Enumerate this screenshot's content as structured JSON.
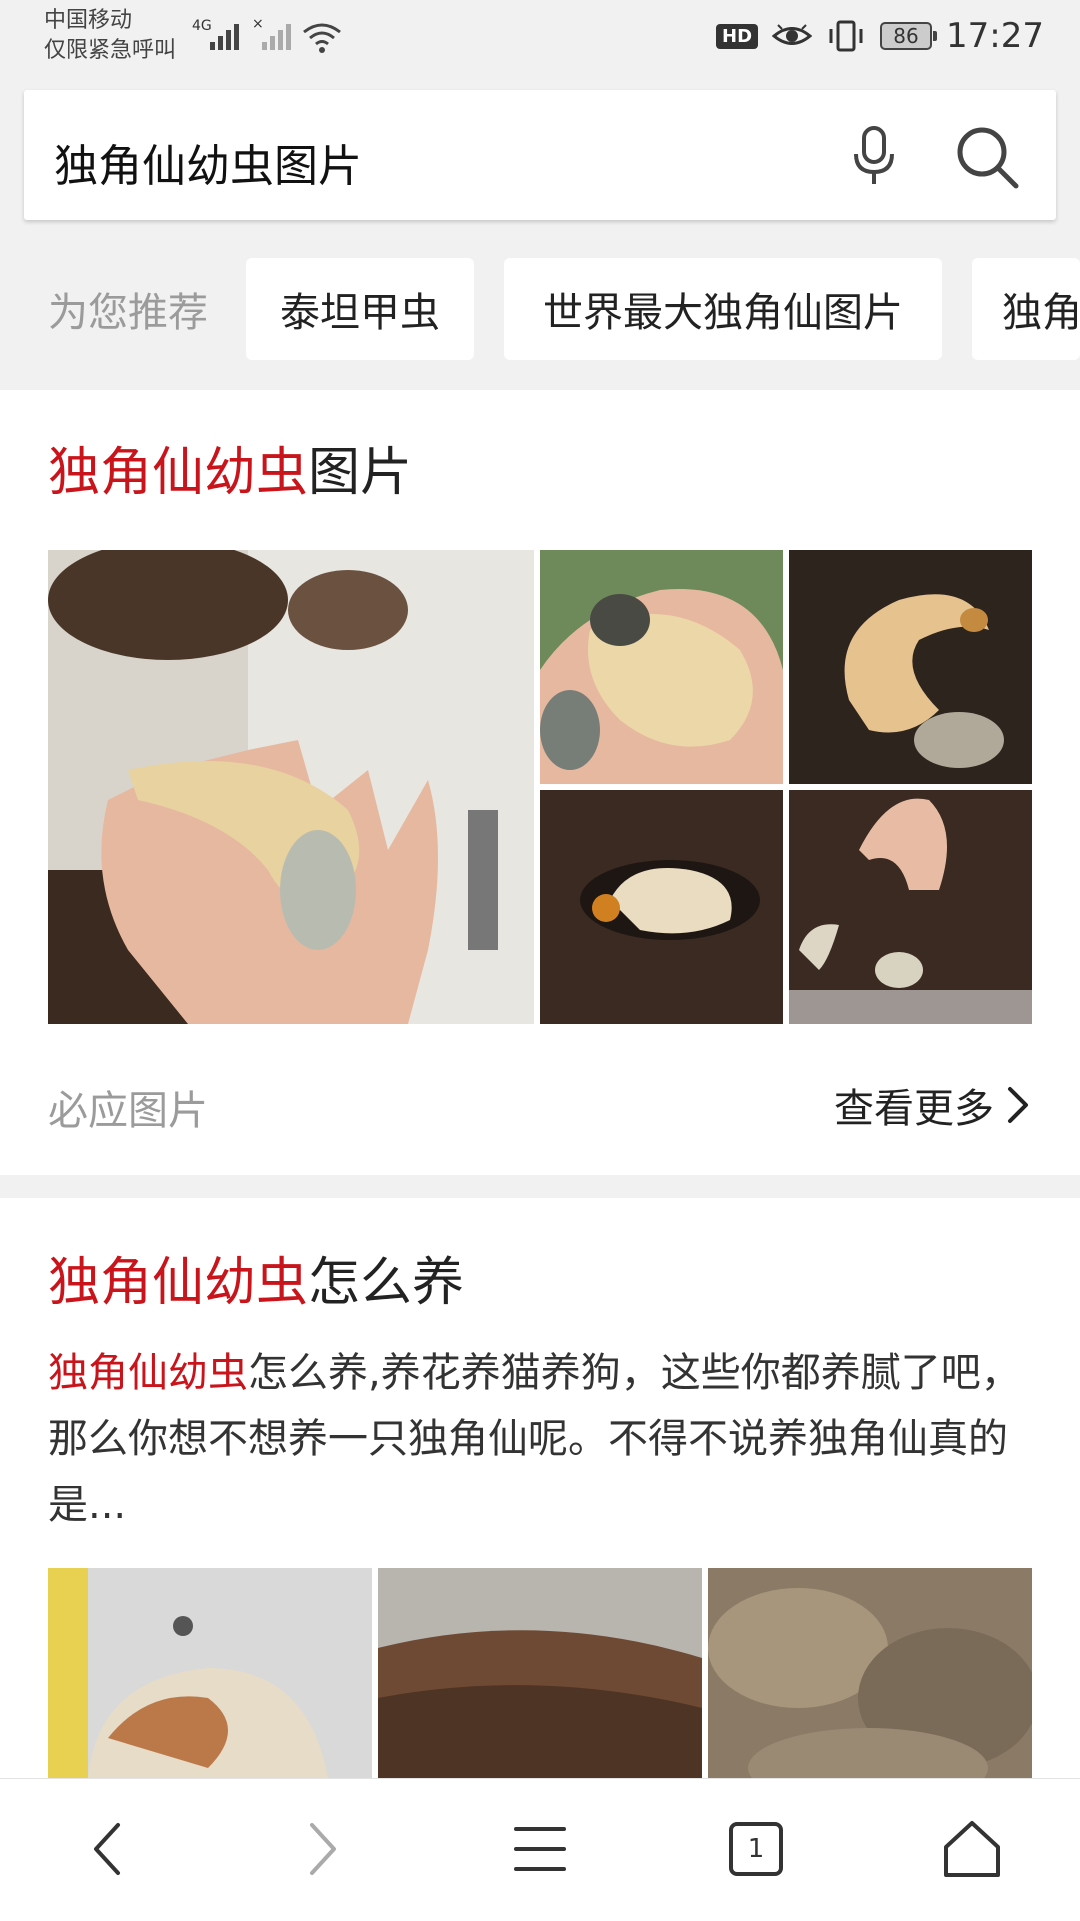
{
  "status_bar": {
    "carrier_line1": "中国移动",
    "carrier_line2": "仅限紧急呼叫",
    "network": "4G",
    "hd": "HD",
    "battery": "86",
    "time": "17:27"
  },
  "search": {
    "query": "独角仙幼虫图片"
  },
  "recommendations": {
    "label": "为您推荐",
    "chips": [
      "泰坦甲虫",
      "世界最大独角仙图片",
      "独角"
    ]
  },
  "image_card": {
    "title_highlight": "独角仙幼虫",
    "title_rest": "图片",
    "source": "必应图片",
    "more": "查看更多"
  },
  "article_card": {
    "title_highlight": "独角仙幼虫",
    "title_rest": "怎么养",
    "snippet_highlight": "独角仙幼虫",
    "snippet_rest": "怎么养,养花养猫养狗，这些你都养腻了吧，那么你想不想养一只独角仙呢。不得不说养独角仙真的是..."
  },
  "bottom_nav": {
    "tab_count": "1"
  },
  "colors": {
    "highlight": "#c8141a",
    "page_bg": "#f1f1f1"
  }
}
